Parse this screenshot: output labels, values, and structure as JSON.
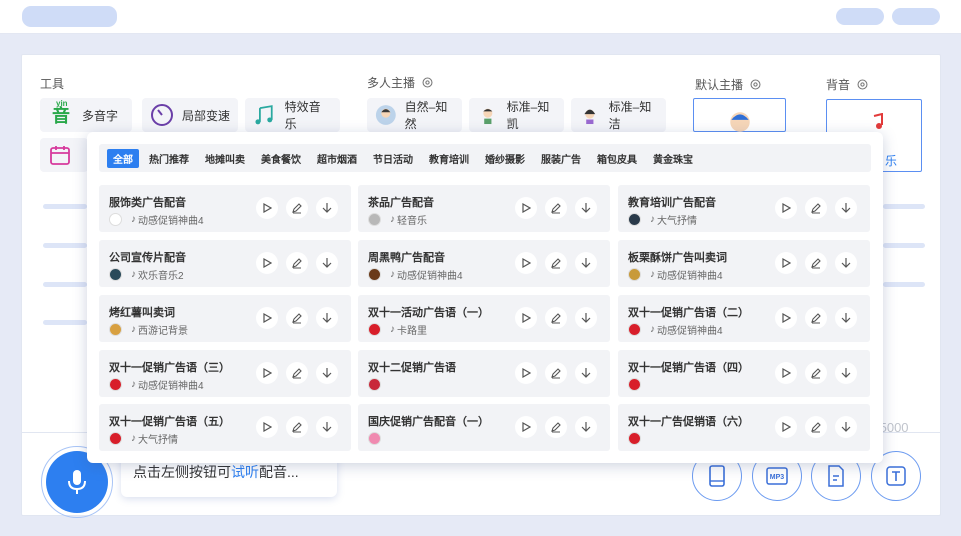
{
  "sections": {
    "tools_title": "工具",
    "multi_anchor_title": "多人主播",
    "default_anchor_title": "默认主播",
    "background_title": "背音"
  },
  "tools": [
    {
      "label": "多音字",
      "icon": "pinyin-icon"
    },
    {
      "label": "局部变速",
      "icon": "speed-gauge-icon"
    },
    {
      "label": "特效音乐",
      "icon": "music-notes-icon"
    },
    {
      "label": "",
      "icon": "calendar-icon"
    }
  ],
  "anchors": [
    {
      "label": "自然–知然",
      "icon": "avatar-icon"
    },
    {
      "label": "标准–知凯",
      "icon": "avatar-icon"
    },
    {
      "label": "标准–知洁",
      "icon": "avatar-icon"
    }
  ],
  "background_music_label": "乐",
  "char_count": "/5000",
  "tip": {
    "prefix": "点击左侧按钮可",
    "highlight": "试听",
    "suffix": "配音..."
  },
  "bottom_tools": [
    {
      "name": "phone-icon"
    },
    {
      "name": "mp3-icon"
    },
    {
      "name": "text-import-icon"
    },
    {
      "name": "text-box-icon"
    }
  ],
  "popup": {
    "tabs": [
      "全部",
      "热门推荐",
      "地摊叫卖",
      "美食餐饮",
      "超市烟酒",
      "节日活动",
      "教育培训",
      "婚纱摄影",
      "服装广告",
      "箱包皮具",
      "黄金珠宝"
    ],
    "active_tab": 0,
    "items": [
      {
        "title": "服饰类广告配音",
        "music": "动感促销神曲4",
        "avatar_color": "#ffffff"
      },
      {
        "title": "茶品广告配音",
        "music": "轻音乐",
        "avatar_color": "#b8b8b8"
      },
      {
        "title": "教育培训广告配音",
        "music": "大气抒情",
        "avatar_color": "#2a3a4a"
      },
      {
        "title": "公司宣传片配音",
        "music": "欢乐音乐2",
        "avatar_color": "#2a4a5a"
      },
      {
        "title": "周黑鸭广告配音",
        "music": "动感促销神曲4",
        "avatar_color": "#6a3a1a"
      },
      {
        "title": "板栗酥饼广告叫卖词",
        "music": "动感促销神曲4",
        "avatar_color": "#c89a3a"
      },
      {
        "title": "烤红薯叫卖词",
        "music": "西游记背景",
        "avatar_color": "#d8a040"
      },
      {
        "title": "双十一活动广告语（一）",
        "music": "卡路里",
        "avatar_color": "#d81e2a"
      },
      {
        "title": "双十一促销广告语（二）",
        "music": "动感促销神曲4",
        "avatar_color": "#d81e2a"
      },
      {
        "title": "双十一促销广告语（三）",
        "music": "动感促销神曲4",
        "avatar_color": "#d81e2a"
      },
      {
        "title": "双十二促销广告语",
        "music": "",
        "avatar_color": "#c8283a"
      },
      {
        "title": "双十一促销广告语（四）",
        "music": "",
        "avatar_color": "#d81e2a"
      },
      {
        "title": "双十一促销广告语（五）",
        "music": "大气抒情",
        "avatar_color": "#d81e2a"
      },
      {
        "title": "国庆促销广告配音（一）",
        "music": "",
        "avatar_color": "#f08ab0"
      },
      {
        "title": "双十一广告促销语（六）",
        "music": "",
        "avatar_color": "#d81e2a"
      }
    ]
  },
  "colors": {
    "accent": "#2d7ff0",
    "skeleton": "#cfdcf7"
  }
}
